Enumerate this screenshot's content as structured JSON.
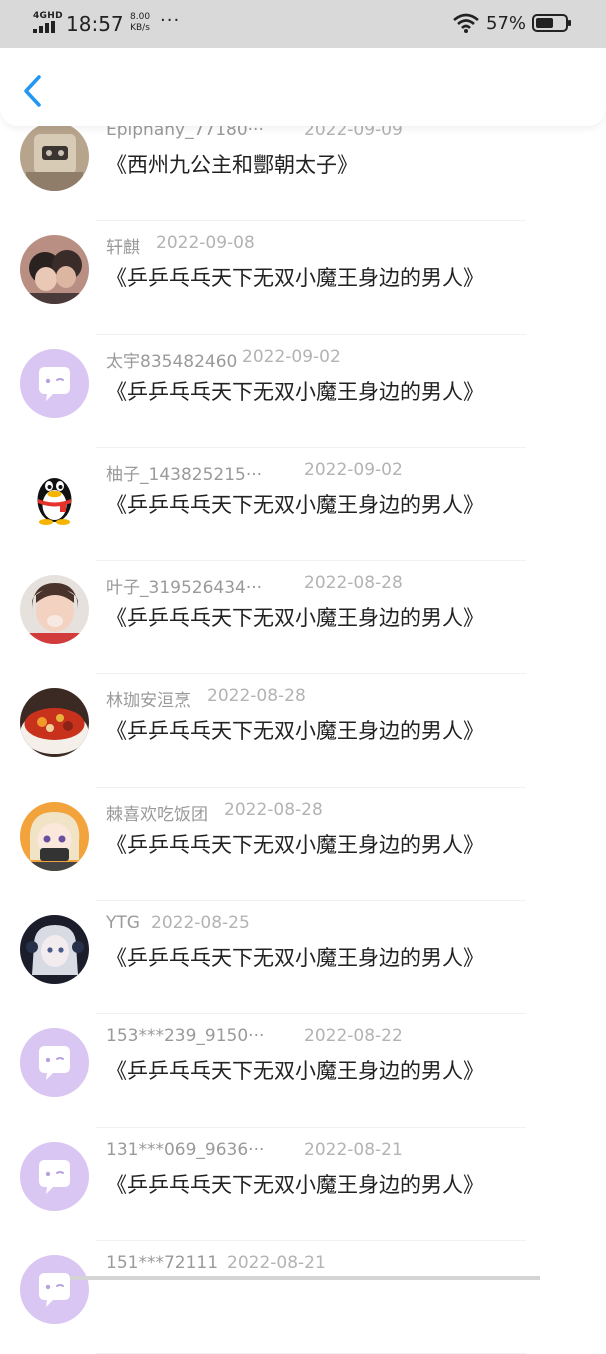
{
  "status_bar": {
    "network": "4GHD",
    "time": "18:57",
    "speed_value": "8.00",
    "speed_unit": "KB/s",
    "more": "···",
    "battery": "57%"
  },
  "header": {
    "back_icon": "chevron-left-icon"
  },
  "comments": [
    {
      "user": "Epiphany_77180···",
      "date": "2022-09-09",
      "title": "《西州九公主和酆朝太子》",
      "avatar": "photo-toys"
    },
    {
      "user": "轩麒",
      "date": "2022-09-08",
      "title": "《乒乒乓乓天下无双小魔王身边的男人》",
      "avatar": "photo-couple"
    },
    {
      "user": "太宇835482460",
      "date": "2022-09-02",
      "title": "《乒乒乓乓天下无双小魔王身边的男人》",
      "avatar": "default-chat"
    },
    {
      "user": "柚子_143825215···",
      "date": "2022-09-02",
      "title": "《乒乒乓乓天下无双小魔王身边的男人》",
      "avatar": "qq-penguin"
    },
    {
      "user": "叶子_319526434···",
      "date": "2022-08-28",
      "title": "《乒乒乓乓天下无双小魔王身边的男人》",
      "avatar": "photo-child"
    },
    {
      "user": "林珈安洹烹",
      "date": "2022-08-28",
      "title": "《乒乒乓乓天下无双小魔王身边的男人》",
      "avatar": "photo-food"
    },
    {
      "user": "棘喜欢吃饭团",
      "date": "2022-08-28",
      "title": "《乒乒乓乓天下无双小魔王身边的男人》",
      "avatar": "anime-girl"
    },
    {
      "user": "YTG",
      "date": "2022-08-25",
      "title": "《乒乒乓乓天下无双小魔王身边的男人》",
      "avatar": "anime-dark"
    },
    {
      "user": "153***239_9150···",
      "date": "2022-08-22",
      "title": "《乒乒乓乓天下无双小魔王身边的男人》",
      "avatar": "default-chat"
    },
    {
      "user": "131***069_9636···",
      "date": "2022-08-21",
      "title": "《乒乒乓乓天下无双小魔王身边的男人》",
      "avatar": "default-chat"
    },
    {
      "user": "151***72111",
      "date": "2022-08-21",
      "title": "",
      "avatar": "default-chat"
    }
  ]
}
